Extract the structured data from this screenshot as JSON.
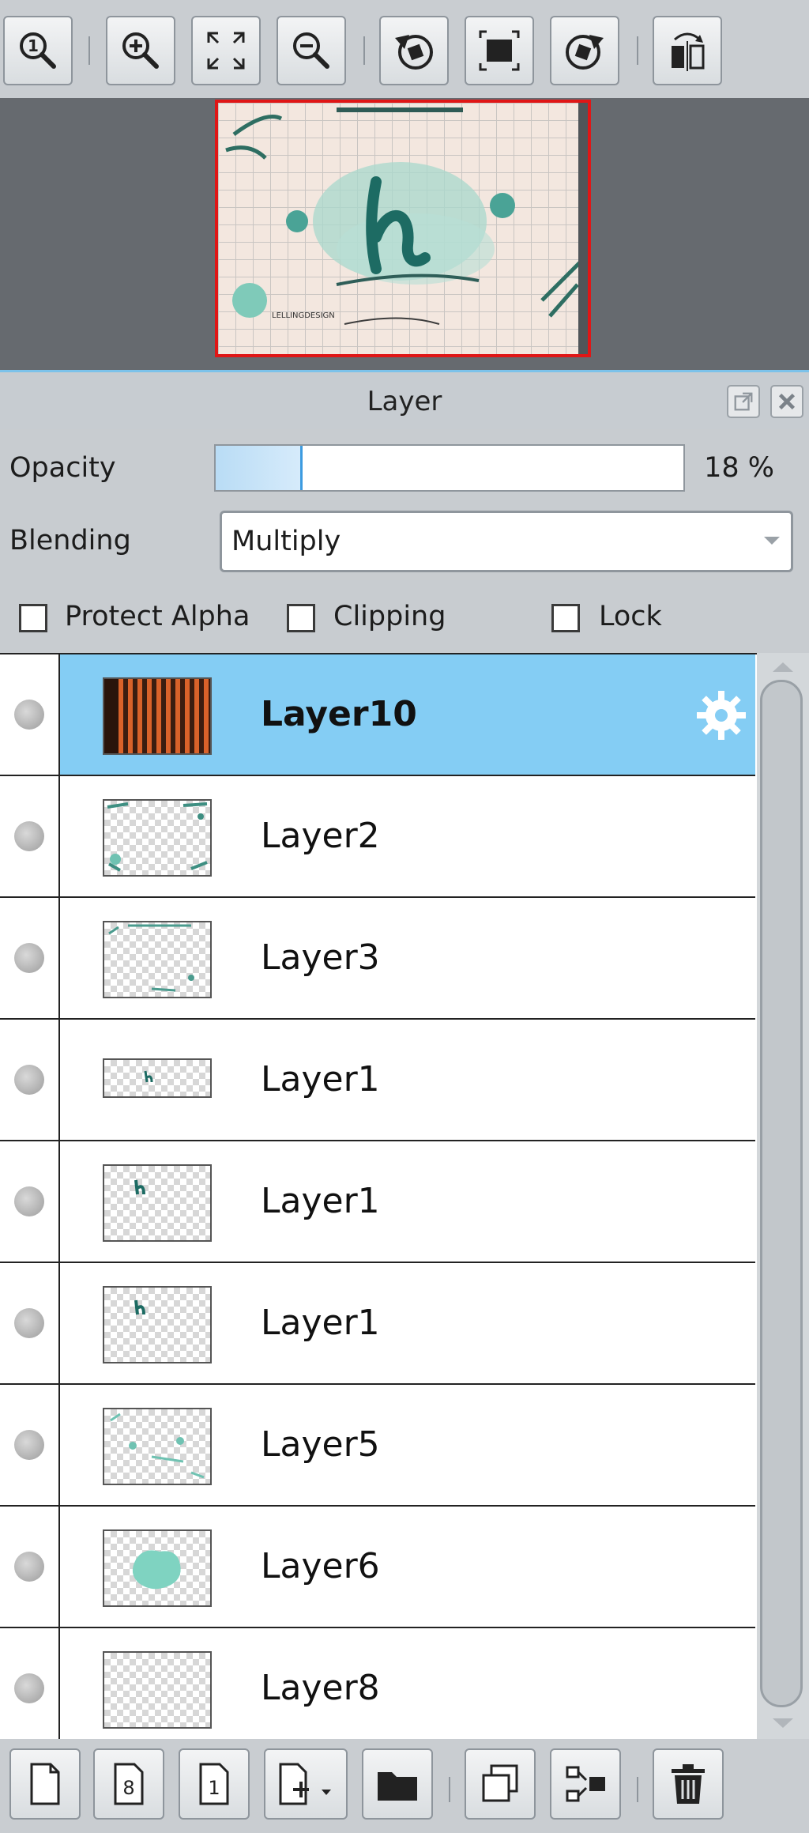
{
  "toolbar": {
    "buttons": [
      "zoom-actual-icon",
      "zoom-in-icon",
      "fit-screen-icon",
      "zoom-out-icon",
      "rotate-left-icon",
      "fit-canvas-icon",
      "rotate-right-icon",
      "flip-horizontal-icon"
    ]
  },
  "panel": {
    "title": "Layer",
    "opacity_label": "Opacity",
    "opacity_value": "18 %",
    "opacity_fraction": 0.18,
    "blending_label": "Blending",
    "blending_value": "Multiply",
    "protect_alpha_label": "Protect Alpha",
    "clipping_label": "Clipping",
    "lock_label": "Lock"
  },
  "layers": [
    {
      "name": "Layer10",
      "selected": true
    },
    {
      "name": "Layer2",
      "selected": false
    },
    {
      "name": "Layer3",
      "selected": false
    },
    {
      "name": "Layer1",
      "selected": false
    },
    {
      "name": "Layer1",
      "selected": false
    },
    {
      "name": "Layer1",
      "selected": false
    },
    {
      "name": "Layer5",
      "selected": false
    },
    {
      "name": "Layer6",
      "selected": false
    },
    {
      "name": "Layer8",
      "selected": false
    }
  ],
  "bottom_toolbar": {
    "buttons": [
      "new-layer-icon",
      "new-8bit-layer-icon",
      "new-1bit-layer-icon",
      "add-layer-menu-icon",
      "new-folder-icon",
      "duplicate-layer-icon",
      "merge-down-icon",
      "delete-layer-icon"
    ]
  },
  "colors": {
    "selected_row": "#84cdf4",
    "accent": "#3c9be0",
    "frame": "#e01616"
  }
}
